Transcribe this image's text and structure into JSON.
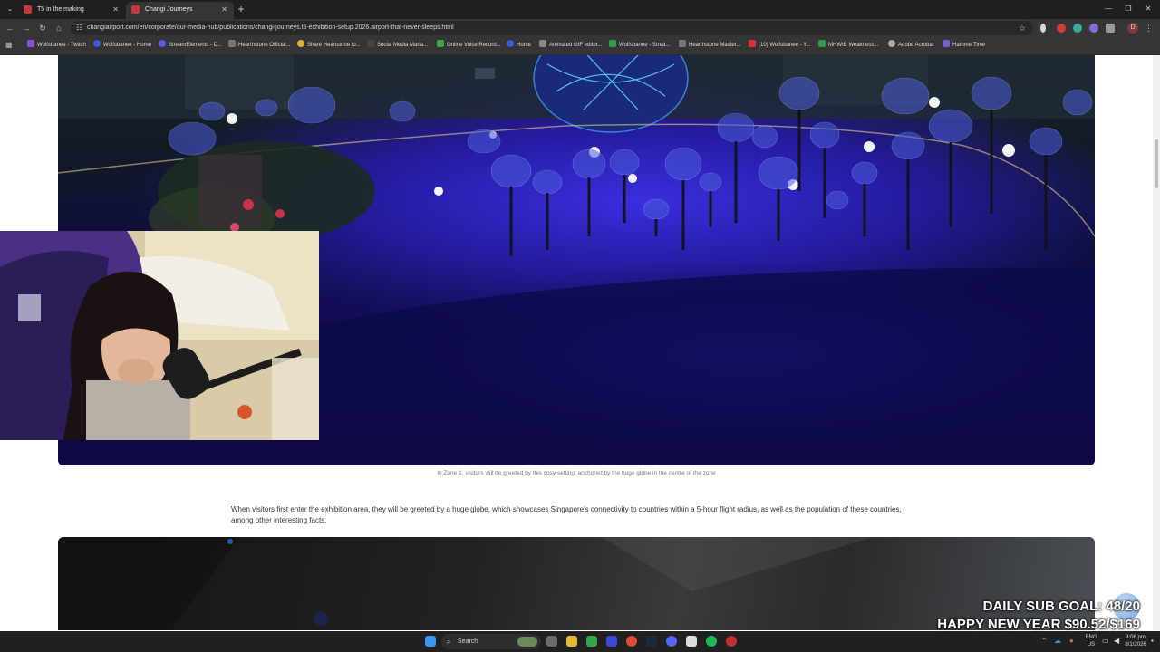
{
  "browser": {
    "tabs": [
      {
        "title": "T5 in the making",
        "active": false
      },
      {
        "title": "Changi Journeys",
        "active": true
      }
    ],
    "url": "changiairport.com/en/corporate/our-media-hub/publications/changi-journeys.t5-exhibition-setup.2026.airport-that-never-sleeps.html",
    "profile_initial": "D",
    "bookmarks": [
      "Wolfsbanee - Twitch",
      "Wolfsbanee - Home",
      "StreamElements - D...",
      "Hearthstone Official...",
      "Share Heartstone to...",
      "Social Media Mana...",
      "Online Voice Record...",
      "Home",
      "Animated GIF editor...",
      "Wolfsbanee - Strea...",
      "Hearthstone Master...",
      "(10) Wolfsbanee - Y...",
      "MHWIB Weakness...",
      "Adobe Acrobat",
      "HammerTime"
    ]
  },
  "article": {
    "caption": "In Zone 1, visitors will be greeted by this cosy setting, anchored by the huge globe in the centre of the zone",
    "paragraph": "When visitors first enter the exhibition area, they will be greeted by a huge globe, which showcases Singapore's connectivity to countries within a 5-hour flight radius, as well as the population of these countries, among other interesting facts."
  },
  "overlay": {
    "sub_goal": "DAILY SUB GOAL: 48/20",
    "new_year": "HAPPY NEW YEAR $90.52/$169"
  },
  "taskbar": {
    "search_label": "Search",
    "lang_top": "ENG",
    "lang_bottom": "US",
    "time": "9:06 pm",
    "date": "8/1/2026"
  },
  "colors": {
    "chrome_dark": "#1f1f1f",
    "toolbar": "#353535",
    "taskbar": "#202020",
    "exhibit_blue": "#2a1fb0"
  }
}
